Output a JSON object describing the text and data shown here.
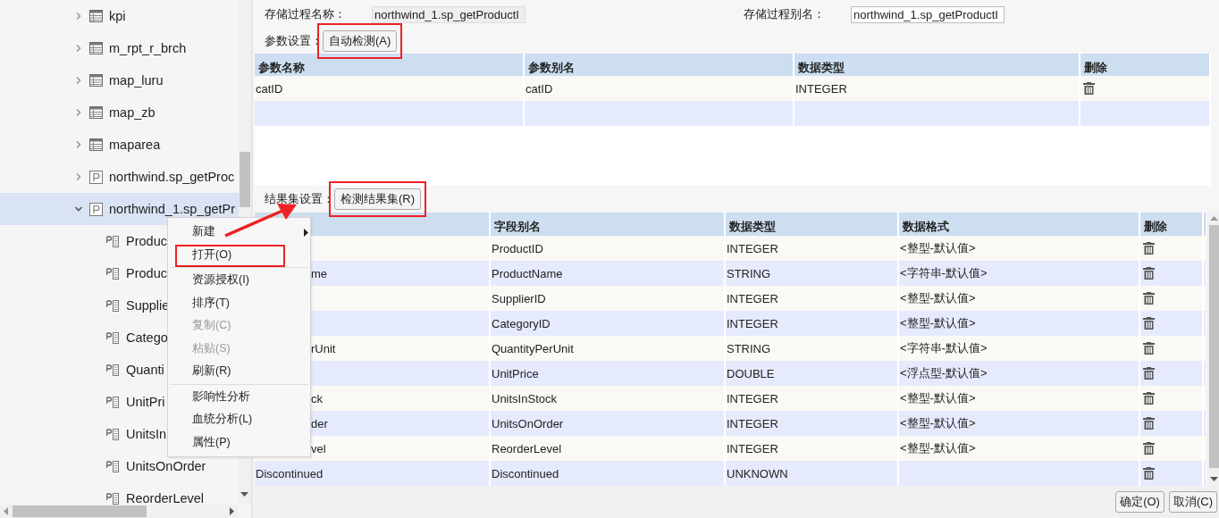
{
  "tree": {
    "items": [
      {
        "label": "kpi",
        "kind": "table",
        "expanded": false,
        "selected": false
      },
      {
        "label": "m_rpt_r_brch",
        "kind": "table",
        "expanded": false,
        "selected": false
      },
      {
        "label": "map_luru",
        "kind": "table",
        "expanded": false,
        "selected": false
      },
      {
        "label": "map_zb",
        "kind": "table",
        "expanded": false,
        "selected": false
      },
      {
        "label": "maparea",
        "kind": "table",
        "expanded": false,
        "selected": false
      },
      {
        "label": "northwind.sp_getProc",
        "kind": "procedure",
        "expanded": false,
        "selected": false
      },
      {
        "label": "northwind_1.sp_getPr",
        "kind": "procedure",
        "expanded": true,
        "selected": true,
        "children": [
          {
            "label": "Produc",
            "kind": "field",
            "selected": false
          },
          {
            "label": "Produc",
            "kind": "field",
            "selected": false
          },
          {
            "label": "Supplie",
            "kind": "field",
            "selected": false
          },
          {
            "label": "Catego",
            "kind": "field",
            "selected": false
          },
          {
            "label": "Quanti",
            "kind": "field",
            "selected": false
          },
          {
            "label": "UnitPri",
            "kind": "field",
            "selected": false
          },
          {
            "label": "UnitsIn",
            "kind": "field",
            "selected": false
          },
          {
            "label": "UnitsOnOrder",
            "kind": "field",
            "selected": false
          },
          {
            "label": "ReorderLevel",
            "kind": "field",
            "selected": false
          }
        ]
      }
    ]
  },
  "context_menu": {
    "groups": [
      [
        {
          "label": "新建",
          "disabled": false,
          "submenu": true,
          "highlighted": false
        },
        {
          "label": "打开(O)",
          "disabled": false,
          "submenu": false,
          "highlighted": true
        }
      ],
      [
        {
          "label": "资源授权(I)",
          "disabled": false,
          "submenu": false,
          "highlighted": false
        },
        {
          "label": "排序(T)",
          "disabled": false,
          "submenu": false,
          "highlighted": false
        },
        {
          "label": "复制(C)",
          "disabled": true,
          "submenu": false,
          "highlighted": false
        },
        {
          "label": "粘贴(S)",
          "disabled": true,
          "submenu": false,
          "highlighted": false
        },
        {
          "label": "刷新(R)",
          "disabled": false,
          "submenu": false,
          "highlighted": false
        }
      ],
      [
        {
          "label": "影响性分析",
          "disabled": false,
          "submenu": false,
          "highlighted": false
        },
        {
          "label": "血统分析(L)",
          "disabled": false,
          "submenu": false,
          "highlighted": false
        },
        {
          "label": "属性(P)",
          "disabled": false,
          "submenu": false,
          "highlighted": false
        }
      ]
    ]
  },
  "form": {
    "name_label": "存储过程名称：",
    "name_value": "northwind_1.sp_getProductI",
    "alias_label": "存储过程别名：",
    "alias_value": "northwind_1.sp_getProductI"
  },
  "params": {
    "label": "参数设置：",
    "button": "自动检测(A)",
    "button_highlighted": true,
    "columns": [
      "参数名称",
      "参数别名",
      "数据类型",
      "删除"
    ],
    "rows": [
      {
        "name": "catID",
        "alias": "catID",
        "type": "INTEGER"
      }
    ]
  },
  "results": {
    "label": "结果集设置：",
    "button": "检测结果集(R)",
    "button_highlighted": true,
    "columns": [
      "字段别名",
      "数据类型",
      "数据格式",
      "删除"
    ],
    "rows": [
      {
        "alias": "ProductID",
        "type": "INTEGER",
        "format": "<整型-默认值>"
      },
      {
        "field": "me",
        "kind": "clipped",
        "alias": "ProductName",
        "type": "STRING",
        "format": "<字符串-默认值>"
      },
      {
        "alias": "SupplierID",
        "type": "INTEGER",
        "format": "<整型-默认值>"
      },
      {
        "alias": "CategoryID",
        "type": "INTEGER",
        "format": "<整型-默认值>"
      },
      {
        "field": "rUnit",
        "kind": "clipped",
        "alias": "QuantityPerUnit",
        "type": "STRING",
        "format": "<字符串-默认值>"
      },
      {
        "alias": "UnitPrice",
        "type": "DOUBLE",
        "format": "<浮点型-默认值>"
      },
      {
        "field": "ck",
        "kind": "clipped",
        "alias": "UnitsInStock",
        "type": "INTEGER",
        "format": "<整型-默认值>"
      },
      {
        "field": "der",
        "kind": "clipped",
        "alias": "UnitsOnOrder",
        "type": "INTEGER",
        "format": "<整型-默认值>"
      },
      {
        "field": "vel",
        "kind": "clipped",
        "alias": "ReorderLevel",
        "type": "INTEGER",
        "format": "<整型-默认值>"
      },
      {
        "field": "Discontinued",
        "kind": "full",
        "alias": "Discontinued",
        "type": "UNKNOWN"
      }
    ]
  },
  "buttons": [
    "确定(O)",
    "取消(C)"
  ]
}
